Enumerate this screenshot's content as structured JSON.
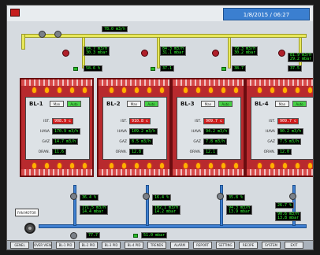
{
  "header": {
    "datetime": "1/8/2015 / 06:27"
  },
  "top_lcd": {
    "main": "78.0 m3/h"
  },
  "top_valves": [
    {
      "a": "84.7 m3/h",
      "b": "30.3 mbar",
      "pct": "58.6 %"
    },
    {
      "a": "84.3 m3/h",
      "b": "31.1 mbar",
      "pct": "37.1"
    },
    {
      "a": "79.3 m3/h",
      "b": "30.2 mbar",
      "pct": "38.7"
    },
    {
      "a": "81.9 m3/h",
      "b": "29.2 mbar",
      "pct": "37.5"
    }
  ],
  "furnaces": [
    {
      "name": "BL-1",
      "man": "Man",
      "auto": "Auto",
      "ist": "908.9 c",
      "hava": "170.9 m3/h",
      "gaz": "14.7 m3/h",
      "oran": "11.6"
    },
    {
      "name": "BL-2",
      "man": "Man",
      "auto": "Auto",
      "ist": "910.8 c",
      "hava": "109.2 m3/h",
      "gaz": "8.5 m3/h",
      "oran": "12.8"
    },
    {
      "name": "BL-3",
      "man": "Man",
      "auto": "Auto",
      "ist": "909.7 c",
      "hava": "94.2 m3/h",
      "gaz": "7.8 m3/h",
      "oran": "12.1"
    },
    {
      "name": "BL-4",
      "man": "Man",
      "auto": "Auto",
      "ist": "909.7 c",
      "hava": "90.2 m3/h",
      "gaz": "7.5 m3/h",
      "oran": "12.0"
    }
  ],
  "labels": {
    "ist": "IST.",
    "hava": "HAVA",
    "gaz": "GAZ",
    "oran": "ORAN."
  },
  "bottom_valves": [
    {
      "pct": "36.4 %",
      "a": "171.5 m3/h",
      "b": "14.4 mbar"
    },
    {
      "pct": "16.4 %",
      "a": "102.1 m3/h",
      "b": "14.2 mbar"
    },
    {
      "pct": "35.8 %",
      "a": "94.3 m3/h",
      "b": "13.9 mbar"
    },
    {
      "pct": "26.7 %",
      "a": "90.6 m3/h",
      "b": "13.8 mbar"
    }
  ],
  "bottom_left": {
    "fan_label": "FAN MOTOR",
    "flow": "77.7",
    "pressure": "51.0 mbar"
  },
  "tabs": [
    "GENEL",
    "OVER VIEW",
    "BL-1 PID",
    "BL-2 PID",
    "BL-3 PID",
    "BL-4 PID",
    "TRENDS",
    "ALARM",
    "REPORT",
    "SETTING",
    "RECIPE",
    "SYSTEM",
    "EXIT"
  ]
}
